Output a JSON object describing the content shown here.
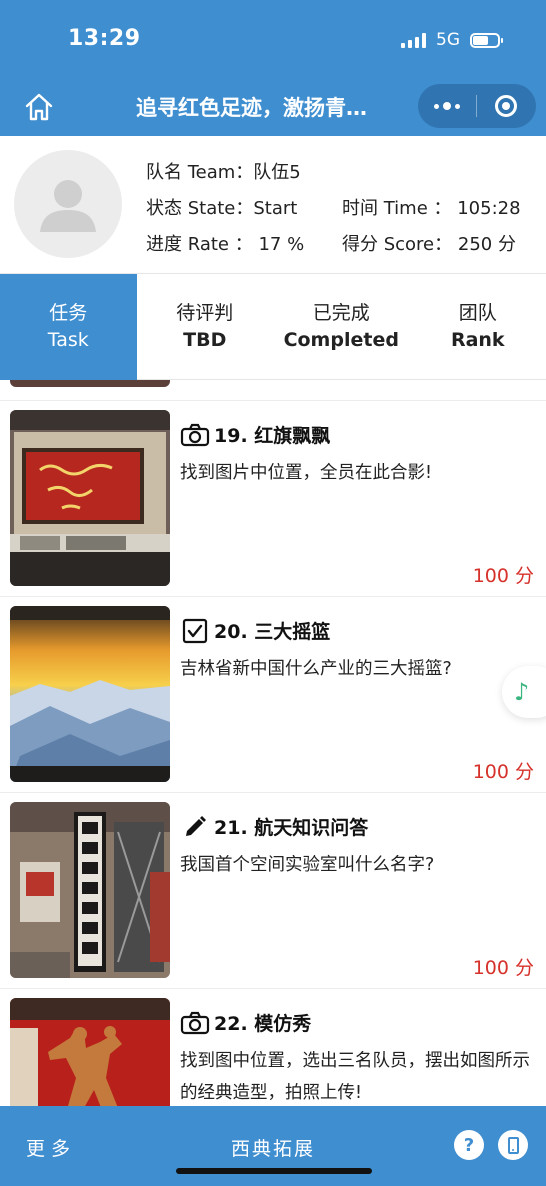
{
  "status_bar": {
    "time": "13:29",
    "network": "5G"
  },
  "nav": {
    "title": "追寻红色足迹，激扬青…"
  },
  "team": {
    "name_label": "队名 Team",
    "name_value": "队伍5",
    "state_label": "状态 State",
    "state_value": "Start",
    "time_label": "时间 Time",
    "time_value": "105:28",
    "rate_label": "进度 Rate",
    "rate_value": "17 %",
    "score_label": "得分 Score",
    "score_value": "250 分"
  },
  "tabs": [
    {
      "zh": "任务",
      "en": "Task",
      "active": true
    },
    {
      "zh": "待评判",
      "en": "TBD",
      "active": false
    },
    {
      "zh": "已完成",
      "en": "Completed",
      "active": false
    },
    {
      "zh": "团队",
      "en": "Rank",
      "active": false
    }
  ],
  "tasks": [
    {
      "icon": "camera-icon",
      "title": "19. 红旗飘飘",
      "desc": "找到图片中位置，全员在此合影!",
      "score": "100 分"
    },
    {
      "icon": "checkbox-icon",
      "title": "20. 三大摇篮",
      "desc": "吉林省新中国什么产业的三大摇篮?",
      "score": "100 分"
    },
    {
      "icon": "pencil-icon",
      "title": "21. 航天知识问答",
      "desc": "我国首个空间实验室叫什么名字?",
      "score": "100 分"
    },
    {
      "icon": "camera-icon",
      "title": "22. 模仿秀",
      "desc": "找到图中位置，选出三名队员，摆出如图所示的经典造型，拍照上传!",
      "score": ""
    }
  ],
  "bottom_bar": {
    "more": "更多",
    "brand": "西典拓展",
    "help": "?"
  },
  "colors": {
    "primary": "#3f8ed0",
    "score": "#d6322b",
    "music": "#3bb57f"
  }
}
